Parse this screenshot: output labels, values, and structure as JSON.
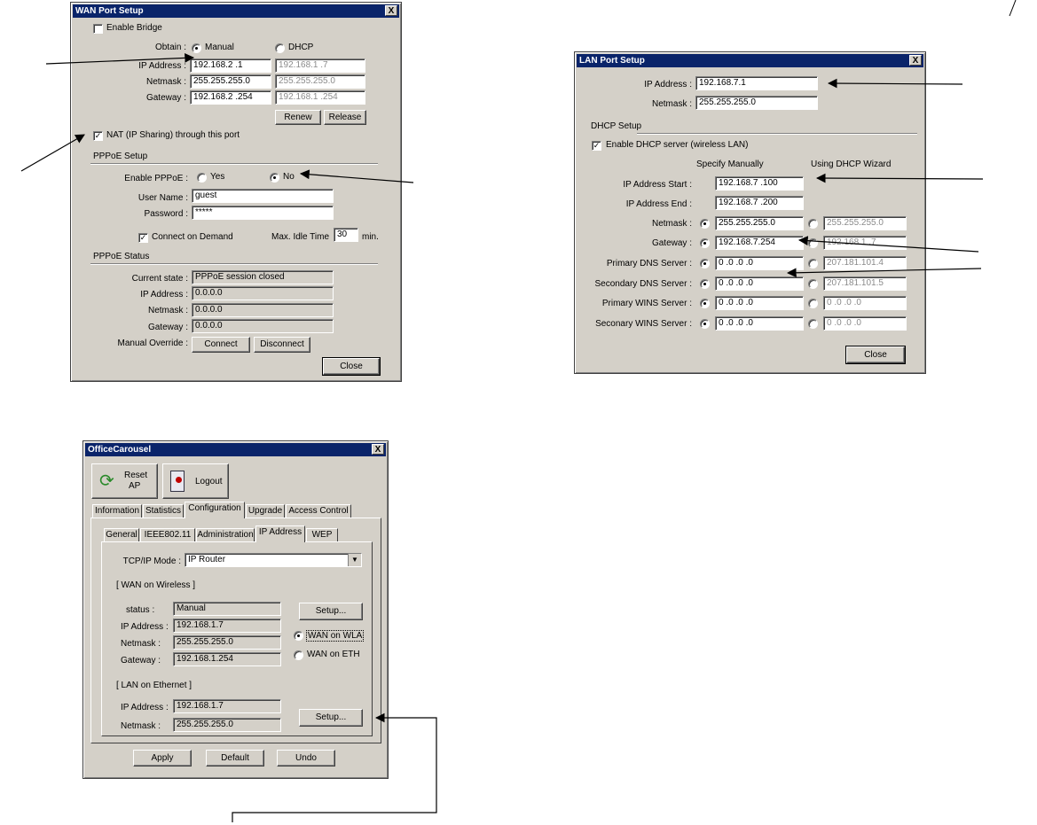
{
  "wan": {
    "title": "WAN Port Setup",
    "close_x": "X",
    "enable_bridge": "Enable Bridge",
    "obtain_label": "Obtain :",
    "opt_manual": "Manual",
    "opt_dhcp": "DHCP",
    "ip_label": "IP Address :",
    "netmask_label": "Netmask :",
    "gateway_label": "Gateway :",
    "ip_manual": "192.168.2  .1",
    "ip_dhcp": "192.168.1  .7",
    "netmask_manual": "255.255.255.0",
    "netmask_dhcp": "255.255.255.0",
    "gateway_manual": "192.168.2  .254",
    "gateway_dhcp": "192.168.1  .254",
    "renew": "Renew",
    "release": "Release",
    "nat": "NAT (IP Sharing) through this port",
    "pppoe_setup": "PPPoE Setup",
    "enable_pppoe": "Enable PPPoE :",
    "opt_yes": "Yes",
    "opt_no": "No",
    "username_label": "User Name :",
    "username": "guest",
    "password_label": "Password :",
    "password": "*****",
    "connect_on_demand": "Connect on Demand",
    "max_idle_label": "Max. Idle Time",
    "max_idle": "30",
    "min": "min.",
    "pppoe_status": "PPPoE Status",
    "current_state_label": "Current state :",
    "current_state": "PPPoE session closed",
    "st_ip_label": "IP Address :",
    "st_ip": "0.0.0.0",
    "st_netmask_label": "Netmask :",
    "st_netmask": "0.0.0.0",
    "st_gateway_label": "Gateway :",
    "st_gateway": "0.0.0.0",
    "manual_override_label": "Manual Override :",
    "connect": "Connect",
    "disconnect": "Disconnect",
    "close": "Close"
  },
  "lan": {
    "title": "LAN Port Setup",
    "close_x": "X",
    "ip_label": "IP Address :",
    "ip": "192.168.7.1",
    "netmask_label": "Netmask :",
    "netmask": "255.255.255.0",
    "dhcp_setup": "DHCP Setup",
    "enable_dhcp": "Enable DHCP server (wireless LAN)",
    "specify_manually": "Specify Manually",
    "using_wizard": "Using DHCP Wizard",
    "ip_start_label": "IP Address Start :",
    "ip_start": "192.168.7  .100",
    "ip_end_label": "IP Address End :",
    "ip_end": "192.168.7  .200",
    "d_netmask_label": "Netmask :",
    "d_netmask": "255.255.255.0",
    "d_netmask_w": "255.255.255.0",
    "d_gateway_label": "Gateway :",
    "d_gateway": "192.168.7.254",
    "d_gateway_w": "192.168.1  .7",
    "pdns_label": "Primary DNS Server :",
    "pdns": "0  .0  .0  .0",
    "pdns_w": "207.181.101.4",
    "sdns_label": "Secondary DNS Server :",
    "sdns": "0  .0  .0  .0",
    "sdns_w": "207.181.101.5",
    "pwins_label": "Primary WINS Server :",
    "pwins": "0  .0  .0  .0",
    "pwins_w": "0  .0  .0  .0",
    "swins_label": "Seconary WINS Server :",
    "swins": "0  .0  .0  .0",
    "swins_w": "0  .0  .0  .0",
    "close": "Close"
  },
  "oc": {
    "title": "OfficeCarousel",
    "close_x": "X",
    "reset_ap": "Reset\nAP",
    "reset_line1": "Reset",
    "reset_line2": "AP",
    "logout": "Logout",
    "tabs_top": [
      "Information",
      "Statistics",
      "Configuration",
      "Upgrade",
      "Access Control"
    ],
    "tabs_sub": [
      "General",
      "IEEE802.11",
      "Administration",
      "IP Address",
      "WEP"
    ],
    "tcpip_label": "TCP/IP Mode :",
    "tcpip_value": "IP Router",
    "wan_wireless": "[ WAN on Wireless ]",
    "status_label": "status :",
    "status": "Manual",
    "ip_label": "IP Address :",
    "ip": "192.168.1.7",
    "netmask_label": "Netmask :",
    "netmask": "255.255.255.0",
    "gateway_label": "Gateway :",
    "gateway": "192.168.1.254",
    "setup1": "Setup...",
    "wan_wla": "WAN on WLA",
    "wan_eth": "WAN on ETH",
    "lan_ethernet": "[ LAN on Ethernet ]",
    "lan_ip_label": "IP Address :",
    "lan_ip": "192.168.1.7",
    "lan_netmask_label": "Netmask :",
    "lan_netmask": "255.255.255.0",
    "setup2": "Setup...",
    "apply": "Apply",
    "default": "Default",
    "undo": "Undo"
  }
}
